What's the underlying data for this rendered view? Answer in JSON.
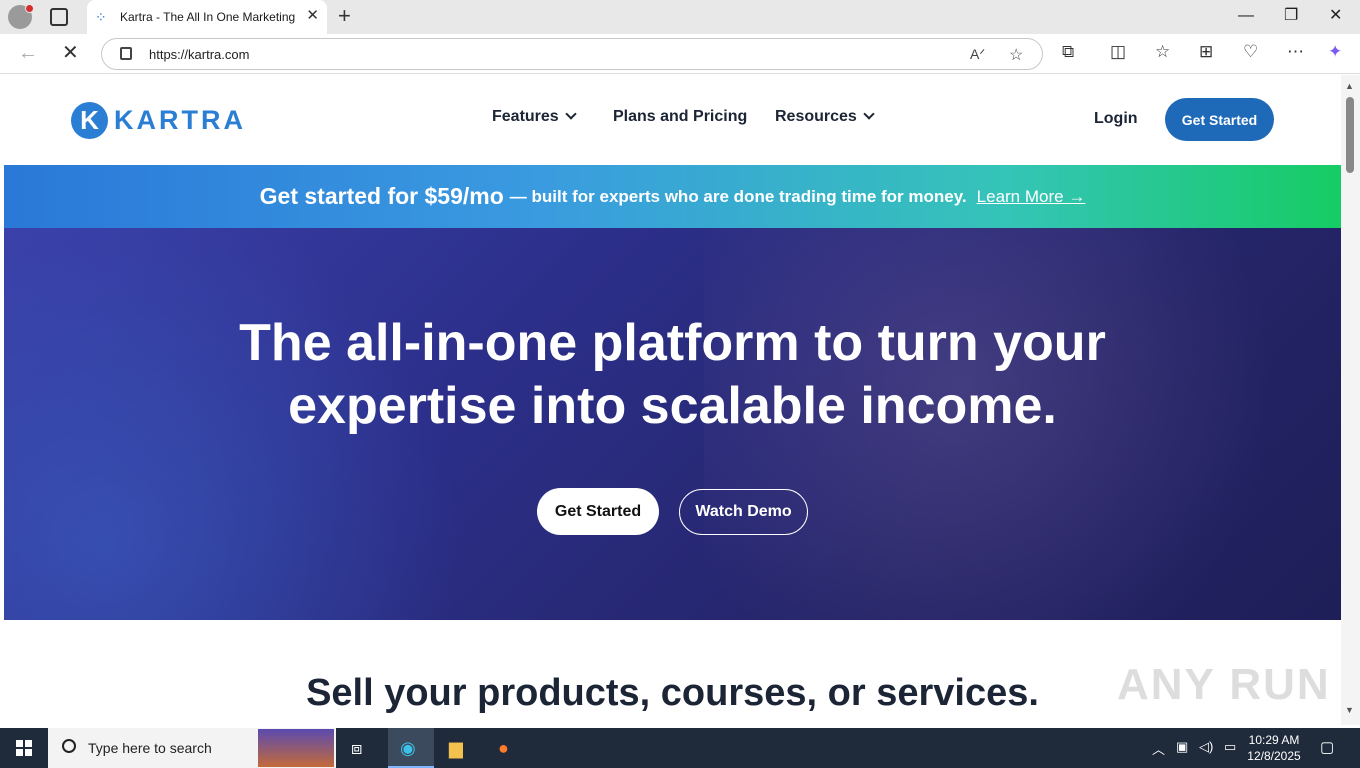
{
  "browser": {
    "tab_title": "Kartra - The All In One Marketing",
    "url": "https://kartra.com"
  },
  "site": {
    "logo_letter": "K",
    "logo_text": "KARTRA",
    "nav": [
      {
        "label": "Features",
        "has_menu": true
      },
      {
        "label": "Plans and Pricing",
        "has_menu": false
      },
      {
        "label": "Resources",
        "has_menu": true
      }
    ],
    "login": "Login",
    "header_cta": "Get Started"
  },
  "promo": {
    "strong": "Get started for $59/mo",
    "rest": "— built for experts who are done trading time for money.",
    "link": "Learn More →"
  },
  "hero": {
    "title_line1": "The all-in-one platform to turn your",
    "title_line2": "expertise into scalable income.",
    "primary_button": "Get Started",
    "secondary_button": "Watch Demo"
  },
  "section": {
    "title": "Sell your products, courses, or services."
  },
  "watermark": "ANY RUN",
  "taskbar": {
    "search_placeholder": "Type here to search",
    "time": "10:29 AM",
    "date": "12/8/2025"
  },
  "colors": {
    "brand_blue": "#2a7fd4",
    "cta_blue": "#1f6ab8",
    "hero_bg": "#2c2f8a"
  }
}
